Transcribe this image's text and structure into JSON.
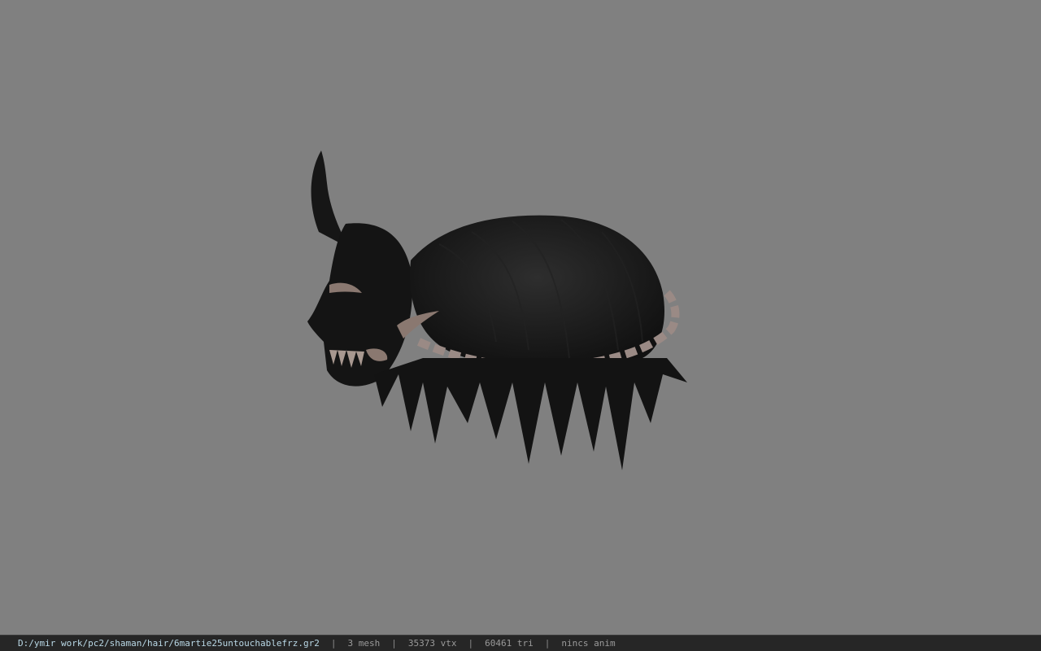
{
  "viewer": {
    "background_color": "#808080",
    "model_description": "shaman-hair-model"
  },
  "status_bar": {
    "file_path": "D:/ymir work/pc2/shaman/hair/6martie25untouchablefrz.gr2",
    "separator": "|",
    "mesh_count": "3 mesh",
    "vertex_count": "35373 vtx",
    "triangle_count": "60461 tri",
    "animation": "nincs anim"
  }
}
